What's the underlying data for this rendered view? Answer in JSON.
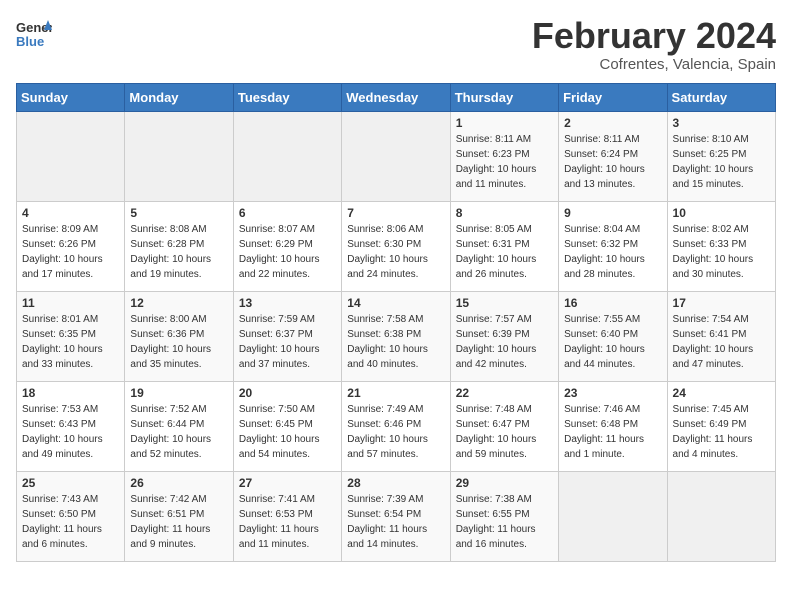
{
  "header": {
    "logo": {
      "text1": "General",
      "text2": "Blue"
    },
    "title": "February 2024",
    "subtitle": "Cofrentes, Valencia, Spain"
  },
  "days_of_week": [
    "Sunday",
    "Monday",
    "Tuesday",
    "Wednesday",
    "Thursday",
    "Friday",
    "Saturday"
  ],
  "weeks": [
    [
      {
        "day": "",
        "info": ""
      },
      {
        "day": "",
        "info": ""
      },
      {
        "day": "",
        "info": ""
      },
      {
        "day": "",
        "info": ""
      },
      {
        "day": "1",
        "info": "Sunrise: 8:11 AM\nSunset: 6:23 PM\nDaylight: 10 hours\nand 11 minutes."
      },
      {
        "day": "2",
        "info": "Sunrise: 8:11 AM\nSunset: 6:24 PM\nDaylight: 10 hours\nand 13 minutes."
      },
      {
        "day": "3",
        "info": "Sunrise: 8:10 AM\nSunset: 6:25 PM\nDaylight: 10 hours\nand 15 minutes."
      }
    ],
    [
      {
        "day": "4",
        "info": "Sunrise: 8:09 AM\nSunset: 6:26 PM\nDaylight: 10 hours\nand 17 minutes."
      },
      {
        "day": "5",
        "info": "Sunrise: 8:08 AM\nSunset: 6:28 PM\nDaylight: 10 hours\nand 19 minutes."
      },
      {
        "day": "6",
        "info": "Sunrise: 8:07 AM\nSunset: 6:29 PM\nDaylight: 10 hours\nand 22 minutes."
      },
      {
        "day": "7",
        "info": "Sunrise: 8:06 AM\nSunset: 6:30 PM\nDaylight: 10 hours\nand 24 minutes."
      },
      {
        "day": "8",
        "info": "Sunrise: 8:05 AM\nSunset: 6:31 PM\nDaylight: 10 hours\nand 26 minutes."
      },
      {
        "day": "9",
        "info": "Sunrise: 8:04 AM\nSunset: 6:32 PM\nDaylight: 10 hours\nand 28 minutes."
      },
      {
        "day": "10",
        "info": "Sunrise: 8:02 AM\nSunset: 6:33 PM\nDaylight: 10 hours\nand 30 minutes."
      }
    ],
    [
      {
        "day": "11",
        "info": "Sunrise: 8:01 AM\nSunset: 6:35 PM\nDaylight: 10 hours\nand 33 minutes."
      },
      {
        "day": "12",
        "info": "Sunrise: 8:00 AM\nSunset: 6:36 PM\nDaylight: 10 hours\nand 35 minutes."
      },
      {
        "day": "13",
        "info": "Sunrise: 7:59 AM\nSunset: 6:37 PM\nDaylight: 10 hours\nand 37 minutes."
      },
      {
        "day": "14",
        "info": "Sunrise: 7:58 AM\nSunset: 6:38 PM\nDaylight: 10 hours\nand 40 minutes."
      },
      {
        "day": "15",
        "info": "Sunrise: 7:57 AM\nSunset: 6:39 PM\nDaylight: 10 hours\nand 42 minutes."
      },
      {
        "day": "16",
        "info": "Sunrise: 7:55 AM\nSunset: 6:40 PM\nDaylight: 10 hours\nand 44 minutes."
      },
      {
        "day": "17",
        "info": "Sunrise: 7:54 AM\nSunset: 6:41 PM\nDaylight: 10 hours\nand 47 minutes."
      }
    ],
    [
      {
        "day": "18",
        "info": "Sunrise: 7:53 AM\nSunset: 6:43 PM\nDaylight: 10 hours\nand 49 minutes."
      },
      {
        "day": "19",
        "info": "Sunrise: 7:52 AM\nSunset: 6:44 PM\nDaylight: 10 hours\nand 52 minutes."
      },
      {
        "day": "20",
        "info": "Sunrise: 7:50 AM\nSunset: 6:45 PM\nDaylight: 10 hours\nand 54 minutes."
      },
      {
        "day": "21",
        "info": "Sunrise: 7:49 AM\nSunset: 6:46 PM\nDaylight: 10 hours\nand 57 minutes."
      },
      {
        "day": "22",
        "info": "Sunrise: 7:48 AM\nSunset: 6:47 PM\nDaylight: 10 hours\nand 59 minutes."
      },
      {
        "day": "23",
        "info": "Sunrise: 7:46 AM\nSunset: 6:48 PM\nDaylight: 11 hours\nand 1 minute."
      },
      {
        "day": "24",
        "info": "Sunrise: 7:45 AM\nSunset: 6:49 PM\nDaylight: 11 hours\nand 4 minutes."
      }
    ],
    [
      {
        "day": "25",
        "info": "Sunrise: 7:43 AM\nSunset: 6:50 PM\nDaylight: 11 hours\nand 6 minutes."
      },
      {
        "day": "26",
        "info": "Sunrise: 7:42 AM\nSunset: 6:51 PM\nDaylight: 11 hours\nand 9 minutes."
      },
      {
        "day": "27",
        "info": "Sunrise: 7:41 AM\nSunset: 6:53 PM\nDaylight: 11 hours\nand 11 minutes."
      },
      {
        "day": "28",
        "info": "Sunrise: 7:39 AM\nSunset: 6:54 PM\nDaylight: 11 hours\nand 14 minutes."
      },
      {
        "day": "29",
        "info": "Sunrise: 7:38 AM\nSunset: 6:55 PM\nDaylight: 11 hours\nand 16 minutes."
      },
      {
        "day": "",
        "info": ""
      },
      {
        "day": "",
        "info": ""
      }
    ]
  ]
}
